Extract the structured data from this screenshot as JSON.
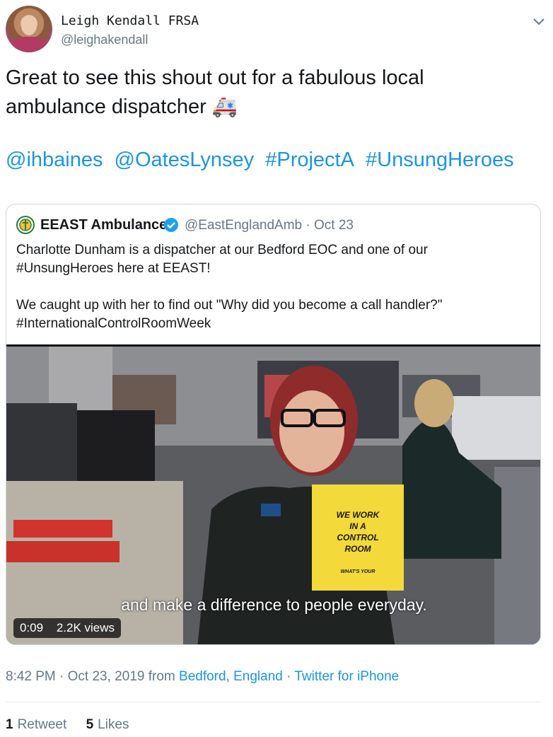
{
  "user": {
    "name": "Leigh Kendall FRSA",
    "handle": "@leighakendall"
  },
  "tweet": {
    "lines": [
      "Great to see this shout out for a fabulous local",
      "ambulance dispatcher"
    ],
    "emoji": "🚑",
    "tags": [
      "@ihbaines",
      "@OatesLynsey",
      "#ProjectA",
      "#UnsungHeroes"
    ]
  },
  "quote": {
    "name": "EEAST Ambulance",
    "handle": "@EastEnglandAmb",
    "separator": "·",
    "date": "Oct 23",
    "para1": [
      "Charlotte Dunham is a dispatcher at our Bedford EOC and one of our",
      "#UnsungHeroes here at EEAST!"
    ],
    "para2": [
      "We caught up with her to find out \"Why did you become a call handler?\"",
      "#InternationalControlRoomWeek"
    ]
  },
  "video": {
    "subtitle": "and make a difference to people everyday.",
    "duration": "0:09",
    "views": "2.2K views",
    "sign_lines": [
      "WE WORK",
      "IN A",
      "CONTROL",
      "ROOM",
      "WHAT'S YOUR"
    ]
  },
  "timeline": {
    "time": "8:42 PM",
    "sep1": "·",
    "date": "Oct 23, 2019",
    "from": "from",
    "location": "Bedford, England",
    "sep2": "·",
    "client": "Twitter for iPhone"
  },
  "stats": {
    "retweets_count": "1",
    "retweets_label": "Retweet",
    "likes_count": "5",
    "likes_label": "Likes"
  },
  "colors": {
    "accent": "#1b95e0",
    "muted": "#657786",
    "verified": "#1da1f2"
  },
  "icons": {
    "chevron": "chevron-down-icon",
    "verified": "verified-badge-icon",
    "logo": "eeast-logo-icon"
  }
}
